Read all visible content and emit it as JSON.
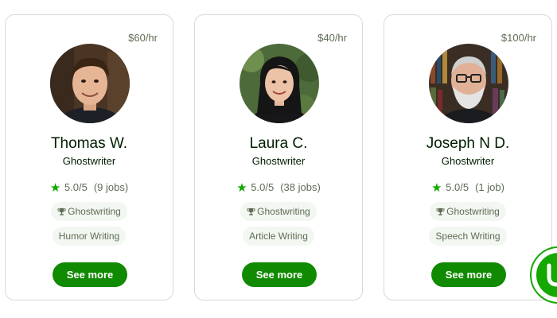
{
  "freelancers": [
    {
      "rate": "$60/hr",
      "name": "Thomas W.",
      "title": "Ghostwriter",
      "rating": "5.0/5",
      "jobs": "(9 jobs)",
      "skills": [
        "Ghostwriting",
        "Humor Writing"
      ],
      "button": "See more"
    },
    {
      "rate": "$40/hr",
      "name": "Laura C.",
      "title": "Ghostwriter",
      "rating": "5.0/5",
      "jobs": "(38 jobs)",
      "skills": [
        "Ghostwriting",
        "Article Writing"
      ],
      "button": "See more"
    },
    {
      "rate": "$100/hr",
      "name": "Joseph N D.",
      "title": "Ghostwriter",
      "rating": "5.0/5",
      "jobs": "(1 job)",
      "skills": [
        "Ghostwriting",
        "Speech Writing"
      ],
      "button": "See more"
    }
  ],
  "icons": {
    "rating": "star-icon",
    "top_skill": "trophy-icon",
    "brand_badge": "upwork-logo-icon"
  },
  "colors": {
    "accent": "#14a800",
    "button": "#108a00",
    "text": "#001e00",
    "muted": "#5e6d55",
    "tag_bg": "#f2f7f2"
  }
}
